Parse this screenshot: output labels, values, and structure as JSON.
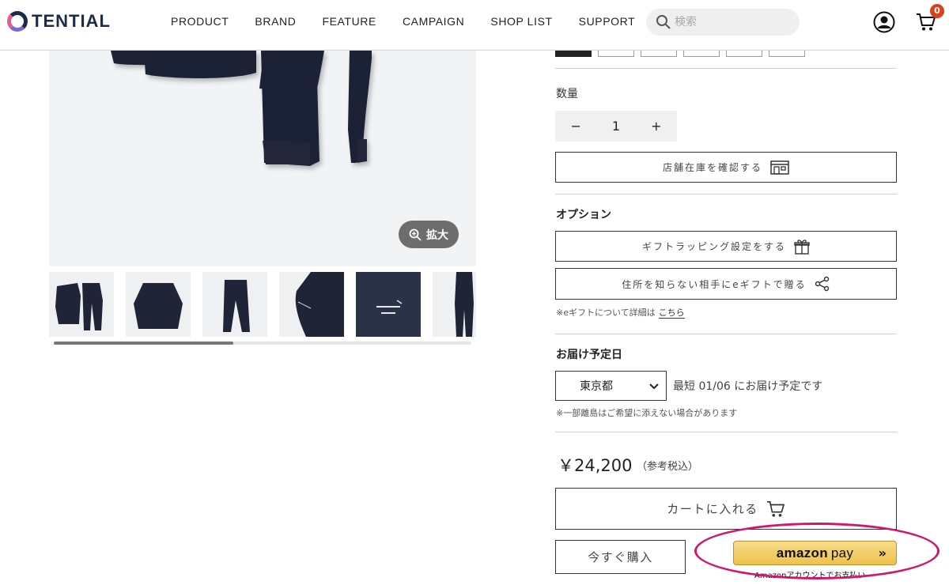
{
  "header": {
    "logo_text": "TENTIAL",
    "nav": [
      "PRODUCT",
      "BRAND",
      "FEATURE",
      "CAMPAIGN",
      "SHOP LIST",
      "SUPPORT"
    ],
    "search_placeholder": "検索",
    "cart_count": "0"
  },
  "gallery": {
    "zoom_label": "拡大",
    "thumbnails": [
      "set",
      "top",
      "pants",
      "sleeve",
      "logo",
      "model"
    ],
    "scroll_progress": 0.43
  },
  "product": {
    "quantity_label": "数量",
    "quantity": "1",
    "minus": "−",
    "plus": "+",
    "store_stock_label": "店舗在庫を確認する",
    "option_label": "オプション",
    "gift_wrap_label": "ギフトラッピング設定をする",
    "egift_label": "住所を知らない相手にeギフトで贈る",
    "egift_note": "※eギフトについて詳細は",
    "egift_link": "こちら",
    "delivery_label": "お届け予定日",
    "prefecture": "東京都",
    "delivery_text": "最短 01/06 にお届け予定です",
    "delivery_note": "※一部離島はご希望に添えない場合があります",
    "price": "￥24,200",
    "price_note": "（参考税込）",
    "add_to_cart": "カートに入れる",
    "buy_now": "今すぐ購入",
    "amazon_brand": "amazon",
    "amazon_pay": "pay",
    "amazon_chevron": "»",
    "amazon_sub": "Amazonアカウントでお支払い"
  },
  "colors": {
    "accent": "#d0176b",
    "navy": "#1c2b4a",
    "amazon": "#eec14b",
    "badge": "#d9421c"
  }
}
